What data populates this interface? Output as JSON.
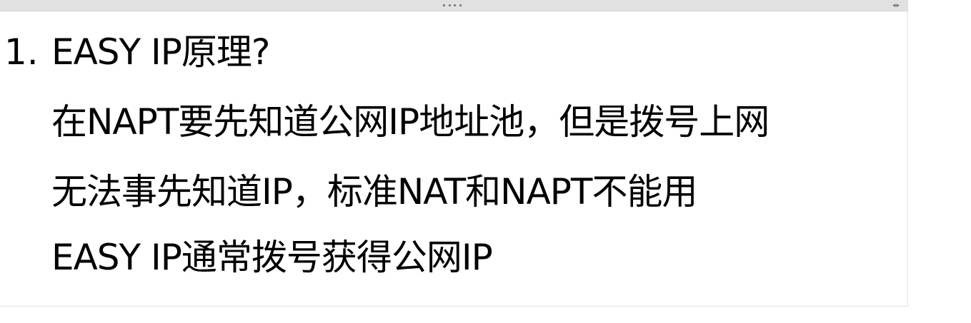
{
  "toolbar": {
    "grip_icon": "drag-handle-dots",
    "arrows_icon": "left-right-arrows",
    "arrows_text": "◂▸"
  },
  "note": {
    "number": "1.",
    "lines": [
      "EASY IP原理?",
      "在NAPT要先知道公网IP地址池，但是拨号上网",
      "无法事先知道IP，标准NAT和NAPT不能用",
      "EASY IP通常拨号获得公网IP"
    ]
  },
  "colors": {
    "topbar": "#e1e1e1",
    "text": "#000000",
    "background": "#ffffff"
  }
}
